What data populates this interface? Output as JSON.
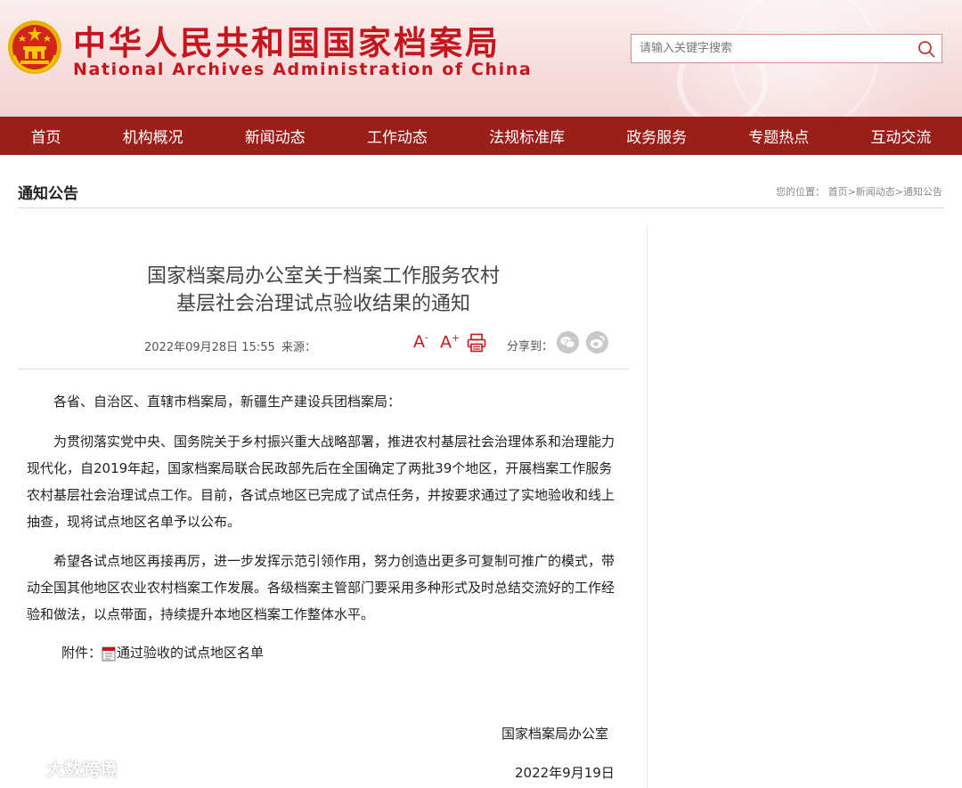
{
  "header": {
    "title_cn": "中华人民共和国国家档案局",
    "title_en": "National Archives Administration of China",
    "search_placeholder": "请输入关键字搜索"
  },
  "nav": {
    "items": [
      "首页",
      "机构概况",
      "新闻动态",
      "工作动态",
      "法规标准库",
      "政务服务",
      "专题热点",
      "互动交流"
    ]
  },
  "section": {
    "title": "通知公告",
    "breadcrumb_prefix": "您的位置：",
    "crumbs": [
      "首页",
      "新闻动态",
      "通知公告"
    ],
    "separator": ">"
  },
  "article": {
    "title_line1": "国家档案局办公室关于档案工作服务农村",
    "title_line2": "基层社会治理试点验收结果的通知",
    "date": "2022年09月28日 15:55",
    "source_label": "来源：",
    "font_larger": "A",
    "font_smaller": "A",
    "share_label": "分享到：",
    "salutation": "各省、自治区、直辖市档案局，新疆生产建设兵团档案局：",
    "paragraph1": "为贯彻落实党中央、国务院关于乡村振兴重大战略部署，推进农村基层社会治理体系和治理能力现代化，自2019年起，国家档案局联合民政部先后在全国确定了两批39个地区，开展档案工作服务农村基层社会治理试点工作。目前，各试点地区已完成了试点任务，并按要求通过了实地验收和线上抽查，现将试点地区名单予以公布。",
    "paragraph2": "希望各试点地区再接再厉，进一步发挥示范引领作用，努力创造出更多可复制可推广的模式，带动全国其他地区农业农村档案工作发展。各级档案主管部门要采用多种形式及时总结交流好的工作经验和做法，以点带面，持续提升本地区档案工作整体水平。",
    "attachment_label": "附件：",
    "attachment_name": "通过验收的试点地区名单",
    "signature_org": "国家档案局办公室",
    "signature_date": "2022年9月19日"
  },
  "watermark": {
    "text": "大数跨境"
  },
  "colors": {
    "brand_red": "#c4161c",
    "nav_bg": "#9a1f19",
    "header_bg": "#f7dede"
  },
  "icons": [
    "national-emblem-icon",
    "search-icon",
    "print-icon",
    "wechat-icon",
    "weibo-icon",
    "file-icon"
  ]
}
